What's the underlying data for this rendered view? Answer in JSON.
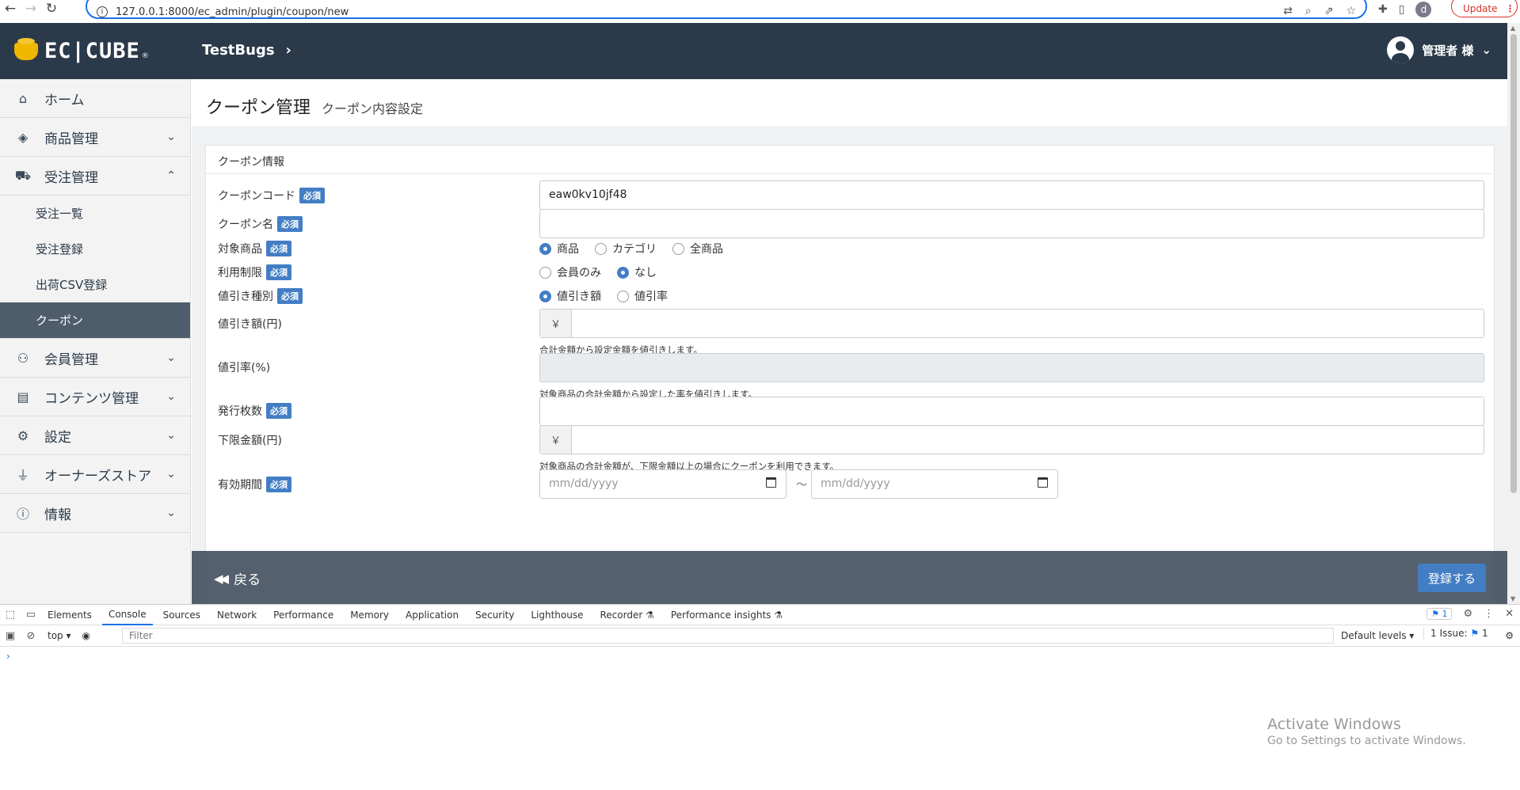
{
  "browser": {
    "url": "127.0.0.1:8000/ec_admin/plugin/coupon/new",
    "update_label": "Update"
  },
  "header": {
    "logo_text": "EC|CUBE",
    "logo_reg": "®",
    "shop_name": "TestBugs",
    "user_label": "管理者 様"
  },
  "sidebar": {
    "items": [
      {
        "label": "ホーム",
        "icon": "home-icon"
      },
      {
        "label": "商品管理",
        "icon": "box-icon"
      },
      {
        "label": "受注管理",
        "icon": "cart-icon"
      },
      {
        "label": "会員管理",
        "icon": "users-icon"
      },
      {
        "label": "コンテンツ管理",
        "icon": "file-icon"
      },
      {
        "label": "設定",
        "icon": "gear-icon"
      },
      {
        "label": "オーナーズストア",
        "icon": "plug-icon"
      },
      {
        "label": "情報",
        "icon": "info-icon"
      }
    ],
    "sub_items": [
      "受注一覧",
      "受注登録",
      "出荷CSV登録",
      "クーポン"
    ]
  },
  "page": {
    "title": "クーポン管理",
    "subtitle": "クーポン内容設定",
    "card_title": "クーポン情報",
    "required_label": "必須"
  },
  "form": {
    "coupon_code_label": "クーポンコード",
    "coupon_code_value": "eaw0kv10jf48",
    "coupon_name_label": "クーポン名",
    "target_label": "対象商品",
    "target_options": [
      "商品",
      "カテゴリ",
      "全商品"
    ],
    "restriction_label": "利用制限",
    "restriction_options": [
      "会員のみ",
      "なし"
    ],
    "discount_type_label": "値引き種別",
    "discount_type_options": [
      "値引き額",
      "値引率"
    ],
    "discount_amount_label": "値引き額(円)",
    "yen": "￥",
    "discount_amount_help": "合計金額から設定金額を値引きします。",
    "discount_rate_label": "値引率(%)",
    "discount_rate_help": "対象商品の合計金額から設定した率を値引きします。",
    "issue_count_label": "発行枚数",
    "min_amount_label": "下限金額(円)",
    "min_amount_help": "対象商品の合計金額が、下限金額以上の場合にクーポンを利用できます。",
    "period_label": "有効期間",
    "date_placeholder": "mm/dd/yyyy",
    "tilde": "～"
  },
  "actions": {
    "back_label": "戻る",
    "register_label": "登録する"
  },
  "devtools": {
    "tabs": [
      "Elements",
      "Console",
      "Sources",
      "Network",
      "Performance",
      "Memory",
      "Application",
      "Security",
      "Lighthouse",
      "Recorder ⚗",
      "Performance insights ⚗"
    ],
    "issues_count": "1",
    "context": "top ▾",
    "filter_placeholder": "Filter",
    "levels": "Default levels ▾",
    "issue_label": "1 Issue:",
    "issue_num": "1",
    "prompt": "›"
  },
  "watermark": {
    "line1": "Activate Windows",
    "line2": "Go to Settings to activate Windows."
  }
}
